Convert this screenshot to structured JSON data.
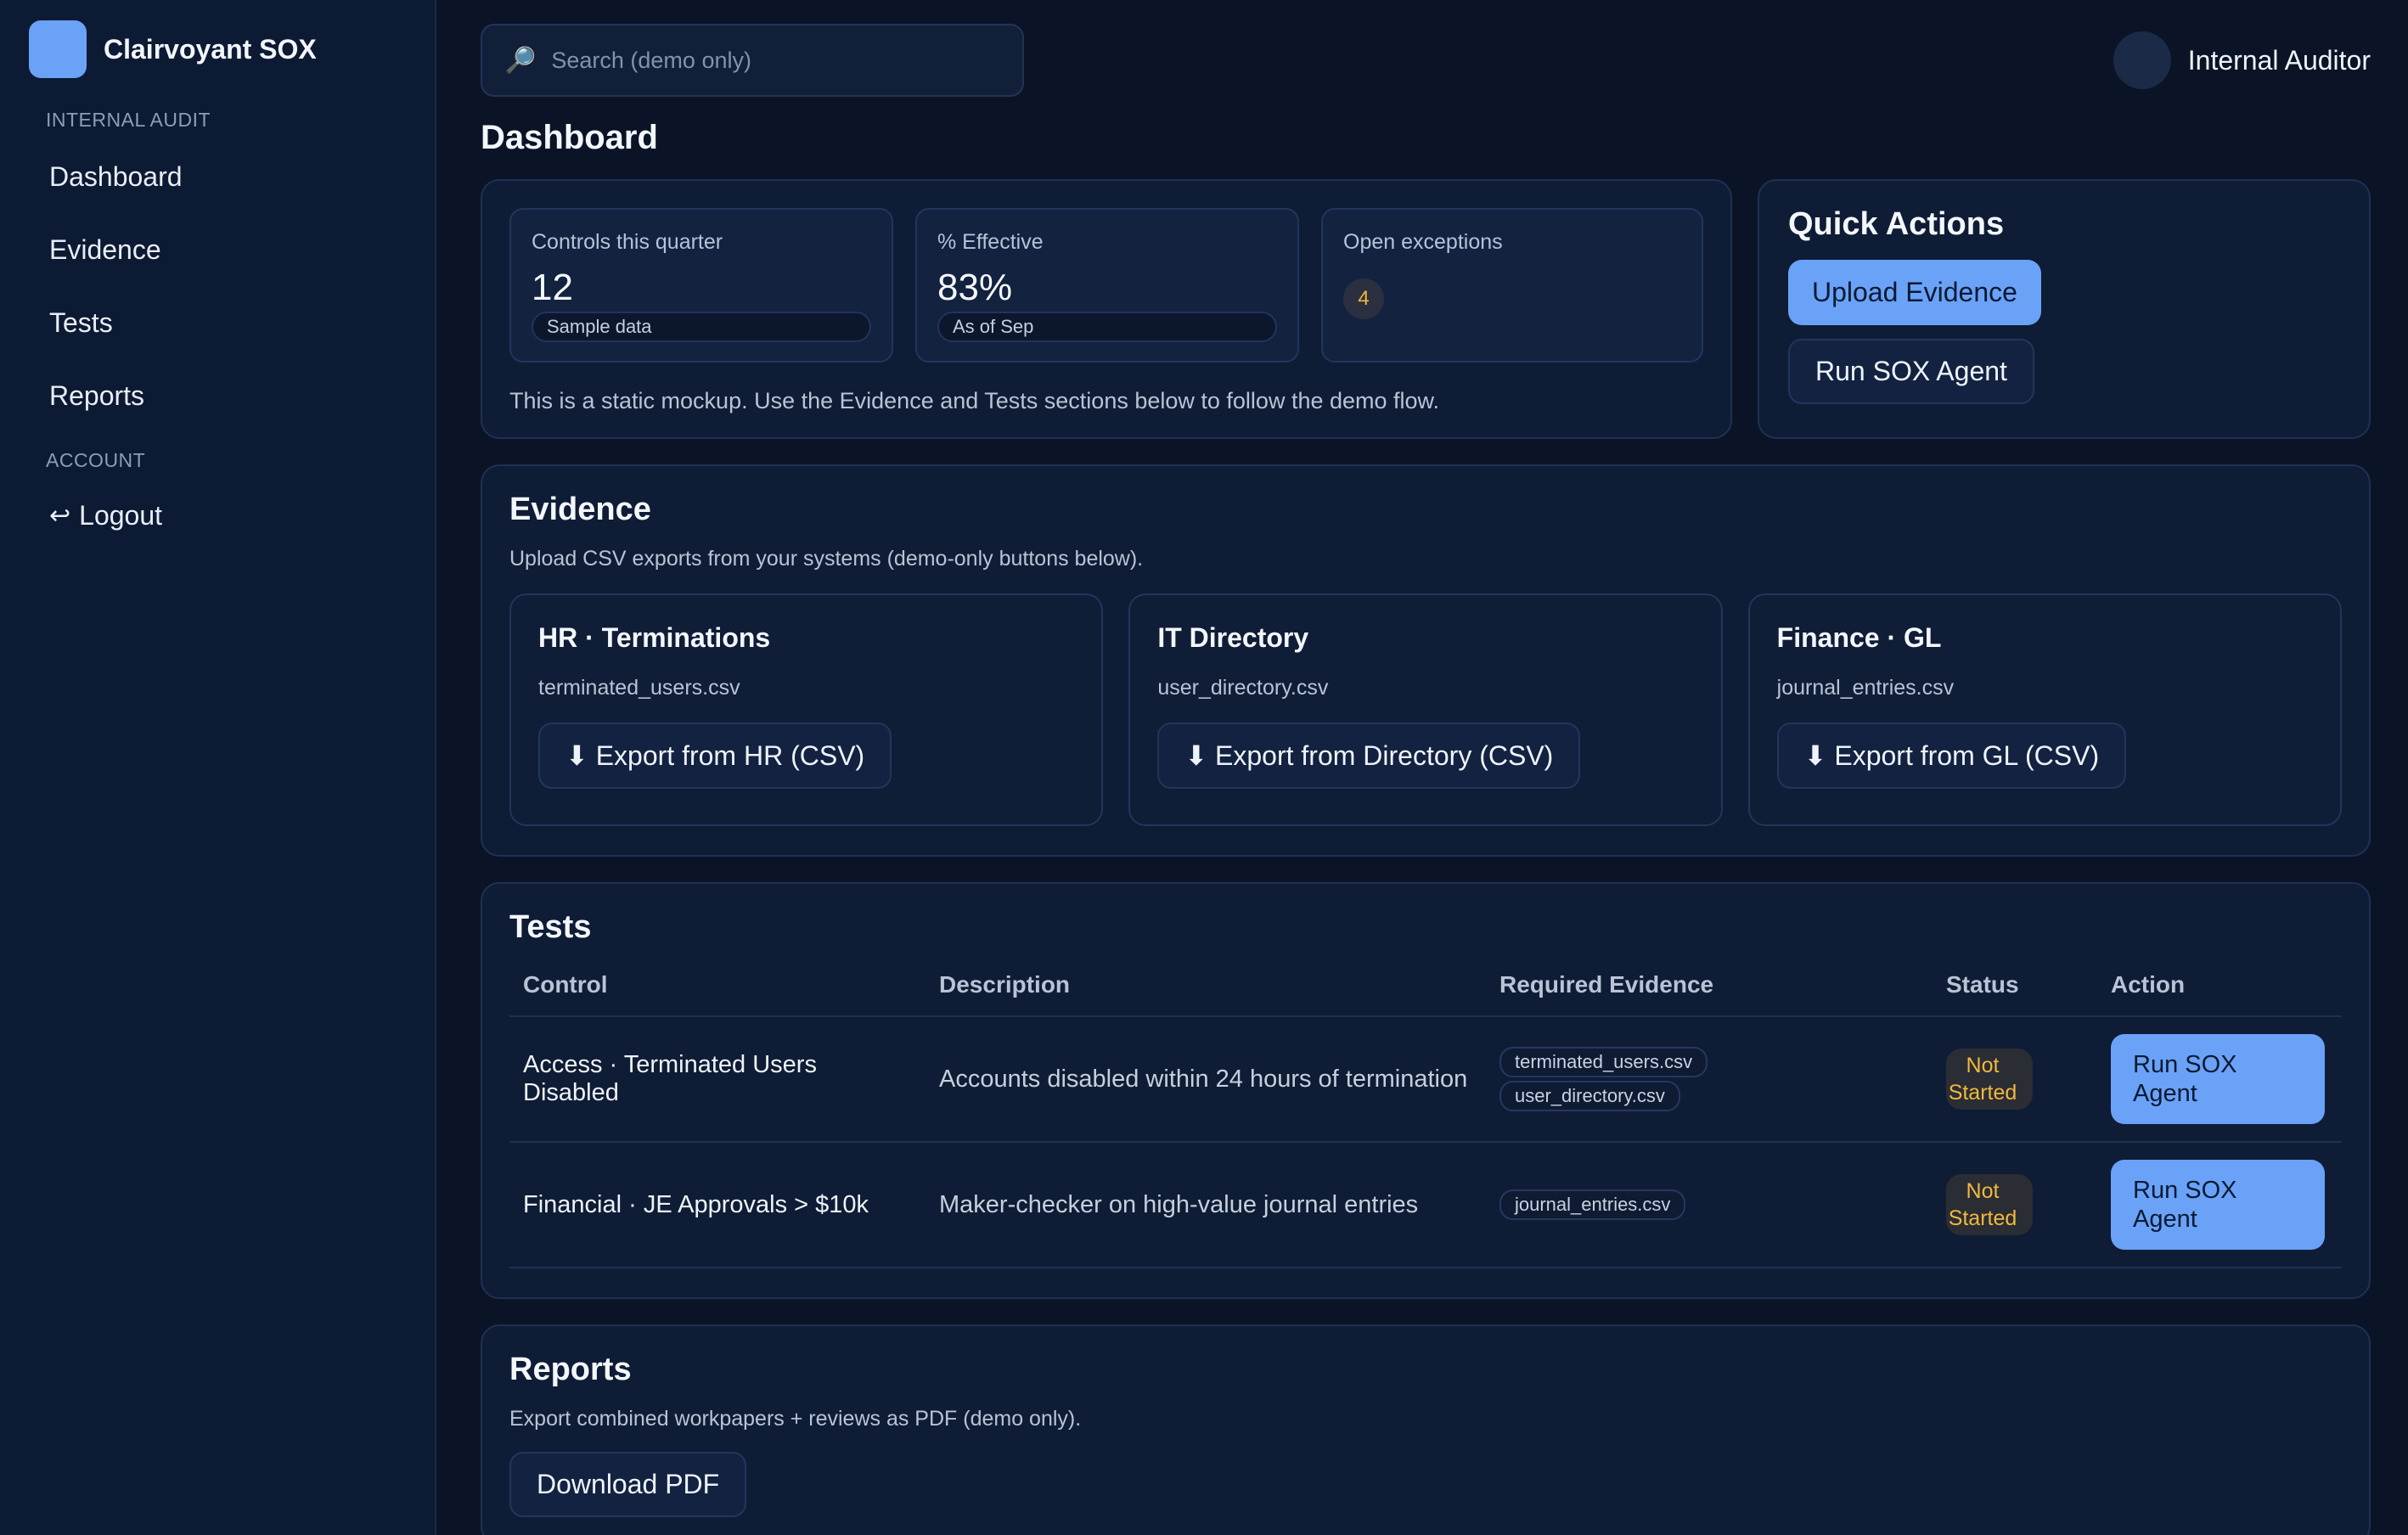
{
  "brand": {
    "name": "Clairvoyant SOX"
  },
  "sidebar": {
    "section_internal": "INTERNAL AUDIT",
    "items": [
      {
        "label": "Dashboard"
      },
      {
        "label": "Evidence"
      },
      {
        "label": "Tests"
      },
      {
        "label": "Reports"
      }
    ],
    "section_account": "ACCOUNT",
    "logout": {
      "glyph": "↩",
      "label": "Logout"
    }
  },
  "search": {
    "placeholder": "Search (demo only)",
    "icon": "search-icon"
  },
  "user": {
    "name": "Internal Auditor"
  },
  "page_title": "Dashboard",
  "overview": {
    "stats": [
      {
        "label": "Controls this quarter",
        "value": "12",
        "sub": "Sample data"
      },
      {
        "label": "% Effective",
        "value": "83%",
        "sub": "As of Sep"
      },
      {
        "label": "Open exceptions",
        "badge": "4"
      }
    ],
    "note": "This is a static mockup. Use the Evidence and Tests sections below to follow the demo flow."
  },
  "quick_actions": {
    "title": "Quick Actions",
    "upload": "Upload Evidence",
    "run": "Run SOX Agent"
  },
  "evidence": {
    "title": "Evidence",
    "desc": "Upload CSV exports from your systems (demo-only buttons below).",
    "cards": [
      {
        "title": "HR · Terminations",
        "file": "terminated_users.csv",
        "button": "⬇ Export from HR (CSV)"
      },
      {
        "title": "IT Directory",
        "file": "user_directory.csv",
        "button": "⬇ Export from Directory (CSV)"
      },
      {
        "title": "Finance · GL",
        "file": "journal_entries.csv",
        "button": "⬇ Export from GL (CSV)"
      }
    ]
  },
  "tests": {
    "title": "Tests",
    "columns": [
      "Control",
      "Description",
      "Required Evidence",
      "Status",
      "Action"
    ],
    "rows": [
      {
        "control": "Access · Terminated Users Disabled",
        "description": "Accounts disabled within 24 hours of termination",
        "evidence": [
          "terminated_users.csv",
          "user_directory.csv"
        ],
        "status_line1": "Not",
        "status_line2": "Started",
        "action": "Run SOX Agent"
      },
      {
        "control": "Financial · JE Approvals > $10k",
        "description": "Maker-checker on high-value journal entries",
        "evidence": [
          "journal_entries.csv"
        ],
        "status_line1": "Not",
        "status_line2": "Started",
        "action": "Run SOX Agent"
      }
    ]
  },
  "reports": {
    "title": "Reports",
    "desc": "Export combined workpapers + reviews as PDF (demo only).",
    "button": "Download PDF"
  },
  "colors": {
    "accent": "#6aa2f7",
    "warning": "#f1b93b",
    "background": "#0b1426"
  }
}
